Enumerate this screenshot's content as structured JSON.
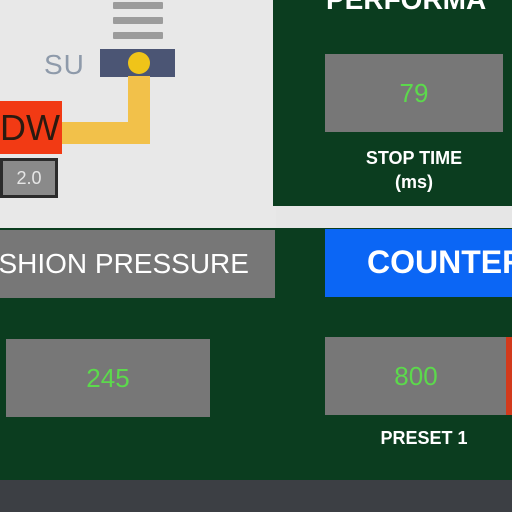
{
  "flow": {
    "su_label": "SU",
    "red_label": "DW",
    "value_box": "2.0"
  },
  "performance": {
    "title": "PERFORMA",
    "stop_time_value": "79",
    "stop_time_label": "STOP TIME",
    "stop_time_unit": "(ms)"
  },
  "cushion": {
    "header": "CUSHION PRESSURE",
    "value": "245"
  },
  "counter": {
    "header": "COUNTER",
    "preset1_value": "800",
    "preset1_label": "PRESET 1"
  },
  "colors": {
    "panel_green": "#0b3d1f",
    "value_green": "#5cd94c",
    "counter_blue": "#0b66f5",
    "alarm_red": "#f23a14",
    "pipe_yellow": "#f2c14a"
  }
}
